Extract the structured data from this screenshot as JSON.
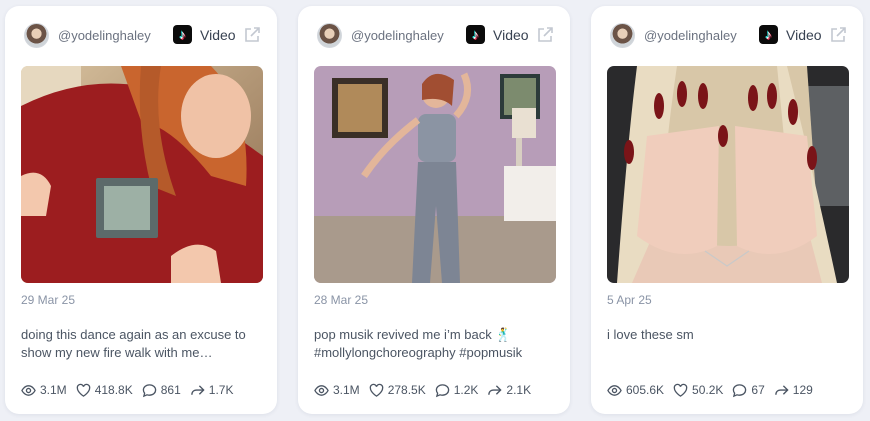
{
  "cards": [
    {
      "username": "@yodelinghaley",
      "type": "Video",
      "date": "29 Mar 25",
      "caption_line1": "doing this dance again as an excuse to",
      "caption_line2": "show my new fire walk with me…",
      "views": "3.1M",
      "likes": "418.8K",
      "comments": "861",
      "shares": "1.7K"
    },
    {
      "username": "@yodelinghaley",
      "type": "Video",
      "date": "28 Mar 25",
      "caption_line1": "pop musik revived me i’m back 🕺",
      "caption_line2": "#mollylongchoreography #popmusik",
      "views": "3.1M",
      "likes": "278.5K",
      "comments": "1.2K",
      "shares": "2.1K"
    },
    {
      "username": "@yodelinghaley",
      "type": "Video",
      "date": "5 Apr 25",
      "caption_line1": "i love these sm",
      "caption_line2": "",
      "views": "605.6K",
      "likes": "50.2K",
      "comments": "67",
      "shares": "129"
    }
  ],
  "icons": {
    "platform": "tiktok-icon",
    "open": "external-link-icon",
    "views": "eye-icon",
    "likes": "heart-icon",
    "comments": "comment-icon",
    "shares": "share-icon"
  }
}
